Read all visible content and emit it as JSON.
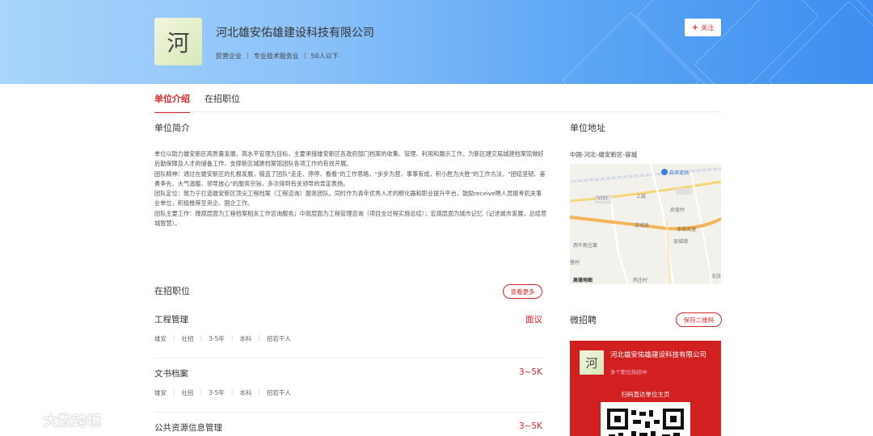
{
  "company": {
    "logo_char": "河",
    "name": "河北雄安佑雄建设科技有限公司",
    "tags": [
      "民营企业",
      "专业技术服务业",
      "50人以下"
    ],
    "follow_label": "关注"
  },
  "tabs": [
    {
      "label": "单位介绍",
      "active": true
    },
    {
      "label": "在招职位",
      "active": false
    }
  ],
  "intro": {
    "title": "单位简介",
    "paragraphs": [
      "单位以助力雄安新区高质量发展，高水平管理为目标，主要承接雄安新区各政府部门档案的收集、管理、利用和展示工作。为新区建交局城建档案馆做好后勤保障及人才的储备工作，支撑新区城建档案馆团队各项工作的有效开展。",
      "团队精神：通过在雄安新区的扎根发展，锻造了团队\"走走、停停、看看\"的工作思路，\"步步为营，事事有成，积小胜为大胜\"的工作方法，\"团结坚韧、奋勇争先、大气温暖、领导放心\"的服务宗旨，多次得到有关领导的肯定表扬。",
      "团队定位：致力于打造雄安新区顶尖工程档案（工程咨询）服务团队。同时作为青年优秀人才的孵化器和职业提升平台，鼓励receive聘人员报考机关事业单位，积极推荐至央企、国企工作。",
      "团队主要工作：微观层面为工程档案相关工作咨询服务；中观层面为工程管理咨询（项目全过程实施总结）；宏观层面为城市记忆（记述城市发展，总结营城智慧）。"
    ]
  },
  "jobs_section": {
    "title": "在招职位",
    "more_label": "查看更多",
    "jobs": [
      {
        "name": "工程管理",
        "salary": "面议",
        "tags": [
          "雄安",
          "社招",
          "3-5年",
          "本科",
          "招若干人"
        ]
      },
      {
        "name": "文书档案",
        "salary": "3~5K",
        "tags": [
          "雄安",
          "社招",
          "3-5年",
          "本科",
          "招若干人"
        ]
      },
      {
        "name": "公共资源信息管理",
        "salary": "3~5K",
        "tags": []
      }
    ]
  },
  "address": {
    "title": "单位地址",
    "text": "中国-河北-雄安新区-容城",
    "map_labels": [
      "白洋淀站",
      "S333",
      "上层",
      "后营村",
      "容城县",
      "津雄高速",
      "容城镇",
      "西午新庄窠",
      "营村",
      "西庄村",
      "北张",
      "高德地图"
    ]
  },
  "micro": {
    "title": "微招聘",
    "save_label": "保存二维码",
    "card_name": "河北雄安佑雄建设科技有限公司",
    "card_sub": "多个职位热招中",
    "card_scan": "扫码直达单位主页"
  },
  "watermark": {
    "text": "大数跨境"
  }
}
